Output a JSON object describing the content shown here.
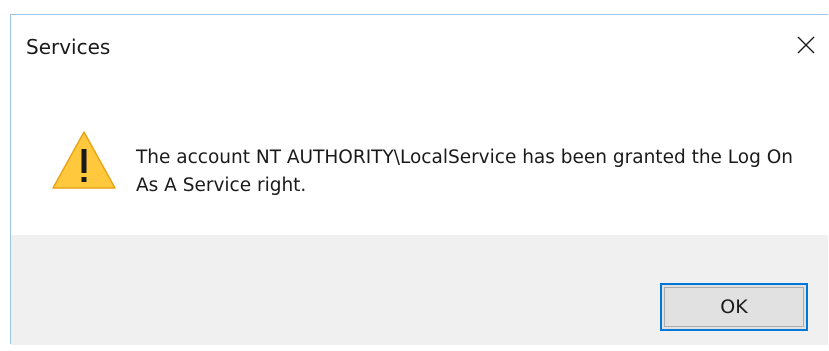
{
  "window": {
    "title": "Services",
    "close_icon": "close-icon"
  },
  "content": {
    "icon": "warning-icon",
    "message": "The account NT AUTHORITY\\LocalService has been granted the Log On As A Service right."
  },
  "footer": {
    "ok_label": "OK"
  },
  "colors": {
    "accent": "#0078d7",
    "footer_bg": "#f0f0f0",
    "warning_fill": "#ffc83d"
  }
}
